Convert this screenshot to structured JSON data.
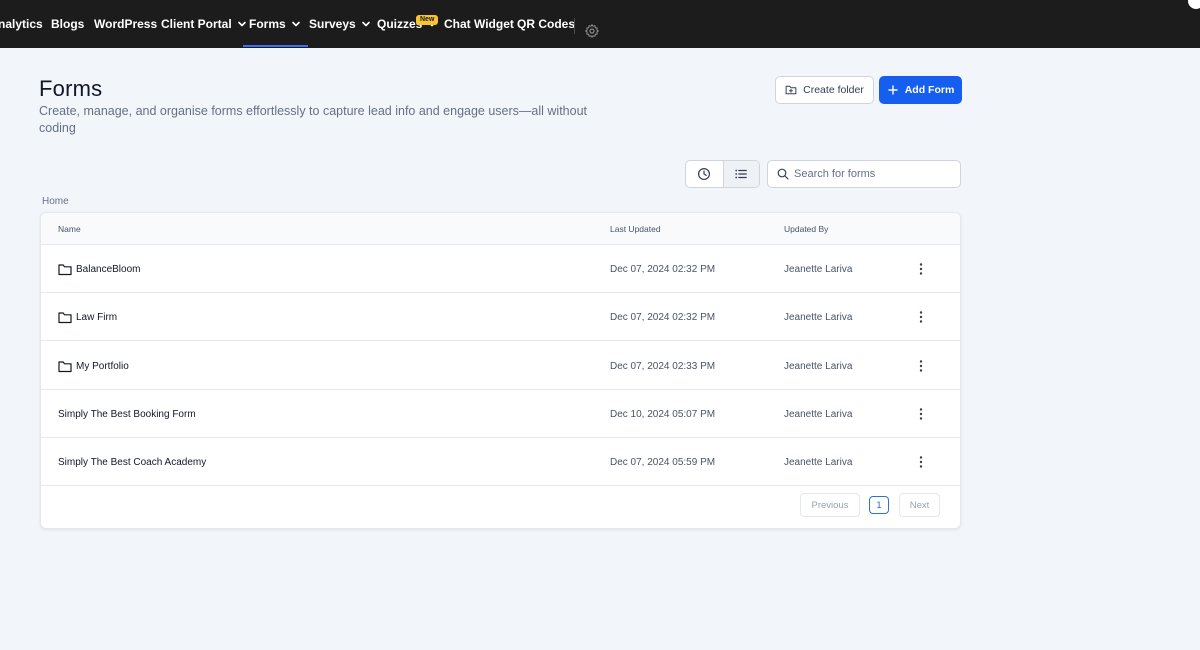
{
  "nav": {
    "items": [
      {
        "label": "nalytics",
        "has_chevron": false
      },
      {
        "label": "Blogs",
        "has_chevron": false
      },
      {
        "label": "WordPress",
        "has_chevron": false
      },
      {
        "label": "Client Portal",
        "has_chevron": true
      },
      {
        "label": "Forms",
        "has_chevron": true,
        "active": true
      },
      {
        "label": "Surveys",
        "has_chevron": true
      },
      {
        "label": "Quizzes",
        "has_chevron": true
      },
      {
        "label": "Chat Widget",
        "has_chevron": false
      },
      {
        "label": "QR Codes",
        "has_chevron": false
      }
    ],
    "new_badge": "New",
    "settings_icon": "gear-icon"
  },
  "header": {
    "title": "Forms",
    "subtitle": "Create, manage, and organise forms effortlessly to capture lead info and engage users—all without coding",
    "create_folder_label": "Create folder",
    "add_form_label": "Add Form"
  },
  "toolbar": {
    "search_placeholder": "Search for forms",
    "view_icons": [
      "clock-icon",
      "list-icon"
    ]
  },
  "breadcrumb": "Home",
  "table": {
    "columns": [
      "Name",
      "Last Updated",
      "Updated By"
    ],
    "rows": [
      {
        "name": "BalanceBloom",
        "is_folder": true,
        "last_updated": "Dec 07, 2024 02:32 PM",
        "updated_by": "Jeanette Lariva"
      },
      {
        "name": "Law Firm",
        "is_folder": true,
        "last_updated": "Dec 07, 2024 02:32 PM",
        "updated_by": "Jeanette Lariva"
      },
      {
        "name": "My Portfolio",
        "is_folder": true,
        "last_updated": "Dec 07, 2024 02:33 PM",
        "updated_by": "Jeanette Lariva"
      },
      {
        "name": "Simply The Best Booking Form",
        "is_folder": false,
        "last_updated": "Dec 10, 2024 05:07 PM",
        "updated_by": "Jeanette Lariva"
      },
      {
        "name": "Simply The Best Coach Academy",
        "is_folder": false,
        "last_updated": "Dec 07, 2024 05:59 PM",
        "updated_by": "Jeanette Lariva"
      }
    ]
  },
  "pagination": {
    "previous_label": "Previous",
    "current_page": "1",
    "next_label": "Next"
  },
  "colors": {
    "primary": "#155eef",
    "nav_bg": "#1c1c1c",
    "page_bg": "#f2f6fa",
    "badge": "#f7c236"
  }
}
